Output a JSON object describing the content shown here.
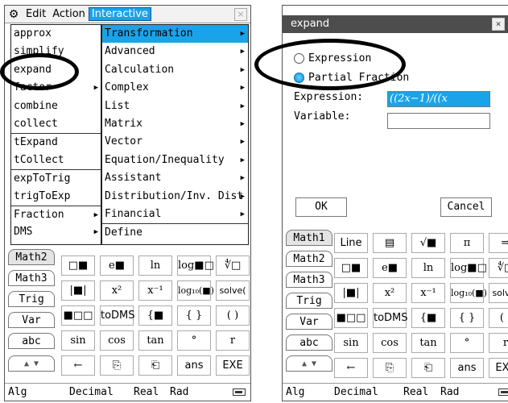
{
  "left": {
    "menubar": {
      "gear": "⚙",
      "items": [
        "Edit",
        "Action",
        "Interactive"
      ],
      "close": "×"
    },
    "menu1": [
      {
        "label": "approx"
      },
      {
        "label": "simplify"
      },
      {
        "label": "expand"
      },
      {
        "label": "factor",
        "arrow": "▶"
      },
      {
        "label": "combine"
      },
      {
        "label": "collect"
      },
      {
        "label": "tExpand"
      },
      {
        "label": "tCollect"
      },
      {
        "label": "expToTrig"
      },
      {
        "label": "trigToExp"
      },
      {
        "label": "Fraction",
        "arrow": "▶"
      },
      {
        "label": "DMS",
        "arrow": "▶"
      }
    ],
    "menu2": [
      {
        "label": "Transformation",
        "arrow": "▶"
      },
      {
        "label": "Advanced",
        "arrow": "▶"
      },
      {
        "label": "Calculation",
        "arrow": "▶"
      },
      {
        "label": "Complex",
        "arrow": "▶"
      },
      {
        "label": "List",
        "arrow": "▶"
      },
      {
        "label": "Matrix",
        "arrow": "▶"
      },
      {
        "label": "Vector",
        "arrow": "▶"
      },
      {
        "label": "Equation/Inequality",
        "arrow": "▶"
      },
      {
        "label": "Assistant",
        "arrow": "▶"
      },
      {
        "label": "Distribution/Inv. Dist",
        "arrow": "▶"
      },
      {
        "label": "Financial",
        "arrow": "▶"
      },
      {
        "label": "Define"
      }
    ],
    "tabs": [
      "Math2",
      "Math3",
      "Trig",
      "Var",
      "abc",
      "▲ ▼"
    ],
    "keys": [
      [
        "□■",
        "e■",
        "ln",
        "log■□",
        "∜□"
      ],
      [
        "|■|",
        "x²",
        "x⁻¹",
        "log₁₀(■)",
        "solve("
      ],
      [
        "■□□",
        "toDMS",
        "{■",
        "{ }",
        "( )"
      ],
      [
        "sin",
        "cos",
        "tan",
        "°",
        "r"
      ],
      [
        "←",
        "⎘",
        "⎗",
        "ans",
        "EXE"
      ]
    ],
    "status": {
      "mode": "Alg",
      "format": "Decimal",
      "num": "Real",
      "angle": "Rad"
    }
  },
  "right": {
    "dialog": {
      "title": "expand",
      "close": "×",
      "opt1": "Expression",
      "opt2": "Partial Fraction",
      "expr_label": "Expression:",
      "expr_value": "((2x−1)/((x",
      "var_label": "Variable:",
      "var_value": "",
      "ok": "OK",
      "cancel": "Cancel"
    },
    "tabs": [
      "Math1",
      "Math2",
      "Math3",
      "Trig",
      "Var",
      "abc",
      "▲ ▼"
    ],
    "keys": [
      [
        "Line",
        "▤",
        "√■",
        "π",
        "⇒"
      ],
      [
        "□■",
        "e■",
        "ln",
        "log■□",
        "∜□"
      ],
      [
        "|■|",
        "x²",
        "x⁻¹",
        "log₁₀(■)",
        "solve("
      ],
      [
        "■□□",
        "toDMS",
        "{■",
        "{ }",
        "( )"
      ],
      [
        "sin",
        "cos",
        "tan",
        "°",
        "r"
      ],
      [
        "←",
        "⎘",
        "⎗",
        "ans",
        "EXE"
      ]
    ],
    "status": {
      "mode": "Alg",
      "format": "Decimal",
      "num": "Real",
      "angle": "Rad"
    }
  },
  "colors": {
    "highlight": "#1aa3e8",
    "title_bar": "#4d4d4d"
  }
}
